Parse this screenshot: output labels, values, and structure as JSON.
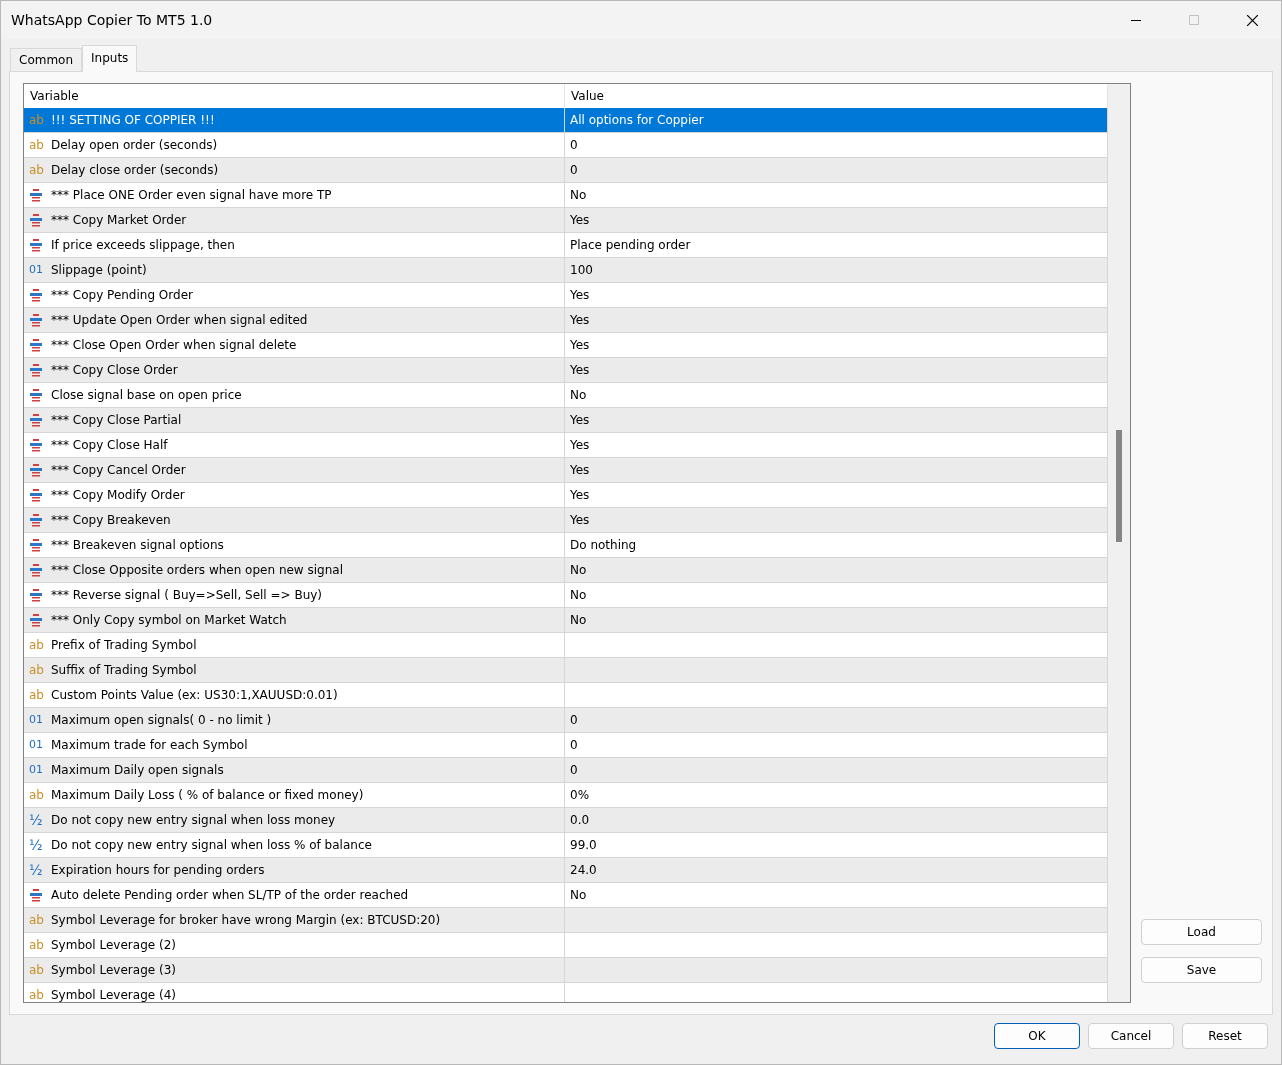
{
  "window": {
    "title": "WhatsApp Copier To MT5 1.0"
  },
  "tabs": [
    {
      "label": "Common",
      "selected": false
    },
    {
      "label": "Inputs",
      "selected": true
    }
  ],
  "table": {
    "columns": [
      "Variable",
      "Value"
    ],
    "rows": [
      {
        "kind": "string",
        "type_icon": "ab",
        "variable": "!!! SETTING OF COPPIER !!!",
        "value": "All options for Coppier",
        "selected": true
      },
      {
        "kind": "string",
        "type_icon": "ab",
        "variable": "Delay open order (seconds)",
        "value": "0",
        "selected": false
      },
      {
        "kind": "string",
        "type_icon": "ab",
        "variable": "Delay close order (seconds)",
        "value": "0",
        "selected": false
      },
      {
        "kind": "enum",
        "variable": "*** Place ONE Order even signal have more TP",
        "value": "No",
        "selected": false
      },
      {
        "kind": "enum",
        "variable": "*** Copy Market Order",
        "value": "Yes",
        "selected": false
      },
      {
        "kind": "enum",
        "variable": "If price exceeds slippage, then",
        "value": "Place pending order",
        "selected": false
      },
      {
        "kind": "int",
        "type_icon": "01",
        "variable": "Slippage (point)",
        "value": "100",
        "selected": false
      },
      {
        "kind": "enum",
        "variable": "*** Copy Pending Order",
        "value": "Yes",
        "selected": false
      },
      {
        "kind": "enum",
        "variable": "*** Update Open Order when signal edited",
        "value": "Yes",
        "selected": false
      },
      {
        "kind": "enum",
        "variable": "*** Close Open Order when signal delete",
        "value": "Yes",
        "selected": false
      },
      {
        "kind": "enum",
        "variable": "*** Copy Close Order",
        "value": "Yes",
        "selected": false
      },
      {
        "kind": "enum",
        "variable": "Close signal base on open price",
        "value": "No",
        "selected": false
      },
      {
        "kind": "enum",
        "variable": "*** Copy Close Partial",
        "value": "Yes",
        "selected": false
      },
      {
        "kind": "enum",
        "variable": "*** Copy Close Half",
        "value": "Yes",
        "selected": false
      },
      {
        "kind": "enum",
        "variable": "*** Copy Cancel Order",
        "value": "Yes",
        "selected": false
      },
      {
        "kind": "enum",
        "variable": "*** Copy Modify Order",
        "value": "Yes",
        "selected": false
      },
      {
        "kind": "enum",
        "variable": "*** Copy Breakeven",
        "value": "Yes",
        "selected": false
      },
      {
        "kind": "enum",
        "variable": "*** Breakeven signal options",
        "value": "Do nothing",
        "selected": false
      },
      {
        "kind": "enum",
        "variable": "*** Close Opposite orders when open new signal",
        "value": "No",
        "selected": false
      },
      {
        "kind": "enum",
        "variable": "*** Reverse signal ( Buy=>Sell, Sell => Buy)",
        "value": "No",
        "selected": false
      },
      {
        "kind": "enum",
        "variable": "*** Only Copy symbol on Market Watch",
        "value": "No",
        "selected": false
      },
      {
        "kind": "string",
        "type_icon": "ab",
        "variable": "Prefix of Trading Symbol",
        "value": "",
        "selected": false
      },
      {
        "kind": "string",
        "type_icon": "ab",
        "variable": "Suffix of Trading Symbol",
        "value": "",
        "selected": false
      },
      {
        "kind": "string",
        "type_icon": "ab",
        "variable": "Custom Points Value (ex: US30:1,XAUUSD:0.01)",
        "value": "",
        "selected": false
      },
      {
        "kind": "int",
        "type_icon": "01",
        "variable": "Maximum open signals( 0 - no limit )",
        "value": "0",
        "selected": false
      },
      {
        "kind": "int",
        "type_icon": "01",
        "variable": "Maximum trade for each Symbol",
        "value": "0",
        "selected": false
      },
      {
        "kind": "int",
        "type_icon": "01",
        "variable": "Maximum Daily open signals",
        "value": "0",
        "selected": false
      },
      {
        "kind": "string",
        "type_icon": "ab",
        "variable": "Maximum Daily Loss ( % of balance or fixed money)",
        "value": "0%",
        "selected": false
      },
      {
        "kind": "double",
        "type_icon": "½",
        "variable": "Do not copy new entry signal when loss money",
        "value": "0.0",
        "selected": false
      },
      {
        "kind": "double",
        "type_icon": "½",
        "variable": "Do not copy new entry signal when loss % of balance",
        "value": "99.0",
        "selected": false
      },
      {
        "kind": "double",
        "type_icon": "½",
        "variable": "Expiration hours for pending orders",
        "value": "24.0",
        "selected": false
      },
      {
        "kind": "enum",
        "variable": "Auto delete Pending order when SL/TP of the order reached",
        "value": "No",
        "selected": false
      },
      {
        "kind": "string",
        "type_icon": "ab",
        "variable": "Symbol Leverage for broker have wrong Margin (ex: BTCUSD:20)",
        "value": "",
        "selected": false
      },
      {
        "kind": "string",
        "type_icon": "ab",
        "variable": "Symbol Leverage (2)",
        "value": "",
        "selected": false
      },
      {
        "kind": "string",
        "type_icon": "ab",
        "variable": "Symbol Leverage (3)",
        "value": "",
        "selected": false
      },
      {
        "kind": "string",
        "type_icon": "ab",
        "variable": "Symbol Leverage (4)",
        "value": "",
        "selected": false
      }
    ]
  },
  "side_buttons": [
    "Load",
    "Save"
  ],
  "footer_buttons": [
    {
      "label": "OK",
      "default": true
    },
    {
      "label": "Cancel",
      "default": false
    },
    {
      "label": "Reset",
      "default": false
    }
  ]
}
